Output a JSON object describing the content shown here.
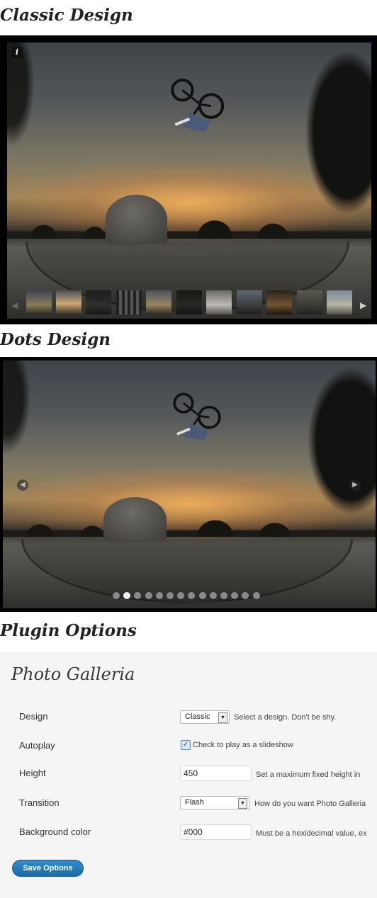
{
  "headings": {
    "classic": "Classic Design",
    "dots": "Dots Design",
    "plugin_options": "Plugin Options"
  },
  "classic_gallery": {
    "info_icon": "i",
    "icons": [
      "info-icon",
      "arrow-left-icon",
      "arrow-right-icon"
    ],
    "thumbnail_count": 12
  },
  "dots_gallery": {
    "dot_count": 14,
    "active_dot_index": 1,
    "icons": [
      "arrow-left-icon",
      "arrow-right-icon"
    ]
  },
  "panel": {
    "title": "Photo Galleria",
    "rows": {
      "design": {
        "label": "Design",
        "value": "Classic",
        "help": "Select a design. Don't be shy."
      },
      "autoplay": {
        "label": "Autoplay",
        "checked": true,
        "help": "Check to play as a slideshow"
      },
      "height": {
        "label": "Height",
        "value": "450",
        "help": "Set a maximum fixed height in"
      },
      "transition": {
        "label": "Transition",
        "value": "Flash",
        "help": "How do you want Photo Galleria"
      },
      "background": {
        "label": "Background color",
        "value": "#000",
        "help": "Must be a hexidecimal value, ex"
      }
    },
    "save_label": "Save Options"
  },
  "colors": {
    "button": "#2479b8",
    "panel_bg": "#f5f5f5",
    "gallery_bg": "#000000"
  }
}
